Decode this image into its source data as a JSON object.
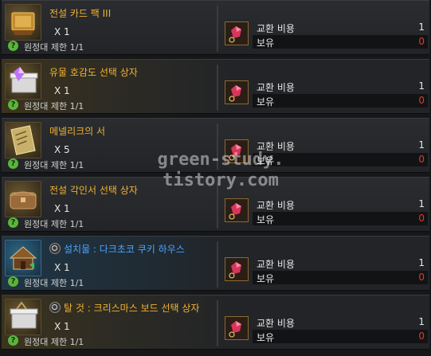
{
  "items": [
    {
      "name": "전설 카드 팩 III",
      "qty": "X 1",
      "limit": "원정대 제한 1/1",
      "cost_label": "교환 비용",
      "cost_value": "1",
      "owned_label": "보유",
      "owned_value": "0",
      "has_search": false,
      "style": "normal"
    },
    {
      "name": "유물 호감도 선택 상자",
      "qty": "X 1",
      "limit": "원정대 제한 1/1",
      "cost_label": "교환 비용",
      "cost_value": "1",
      "owned_label": "보유",
      "owned_value": "0",
      "has_search": false,
      "style": "gold"
    },
    {
      "name": "메넬리크의 서",
      "qty": "X 5",
      "limit": "원정대 제한 1/1",
      "cost_label": "교환 비용",
      "cost_value": "1",
      "owned_label": "보유",
      "owned_value": "0",
      "has_search": false,
      "style": "normal"
    },
    {
      "name": "전설 각인서 선택 상자",
      "qty": "X 1",
      "limit": "원정대 제한 1/1",
      "cost_label": "교환 비용",
      "cost_value": "1",
      "owned_label": "보유",
      "owned_value": "0",
      "has_search": false,
      "style": "normal"
    },
    {
      "name": "설치물 : 다크초코 쿠키 하우스",
      "qty": "X 1",
      "limit": "원정대 제한 1/1",
      "cost_label": "교환 비용",
      "cost_value": "1",
      "owned_label": "보유",
      "owned_value": "0",
      "has_search": true,
      "style": "blue"
    },
    {
      "name": "탈 것 : 크리스마스 보드 선택 상자",
      "qty": "X 1",
      "limit": "원정대 제한 1/1",
      "cost_label": "교환 비용",
      "cost_value": "1",
      "owned_label": "보유",
      "owned_value": "0",
      "has_search": true,
      "style": "gold"
    }
  ],
  "watermark": {
    "line1": "green-study.",
    "line2": "tistory.com"
  },
  "colors": {
    "name_gold": "#f0b232",
    "name_blue": "#4aa3ff",
    "owned_red": "#e03a2f",
    "limit_icon": "#5bb53b"
  }
}
